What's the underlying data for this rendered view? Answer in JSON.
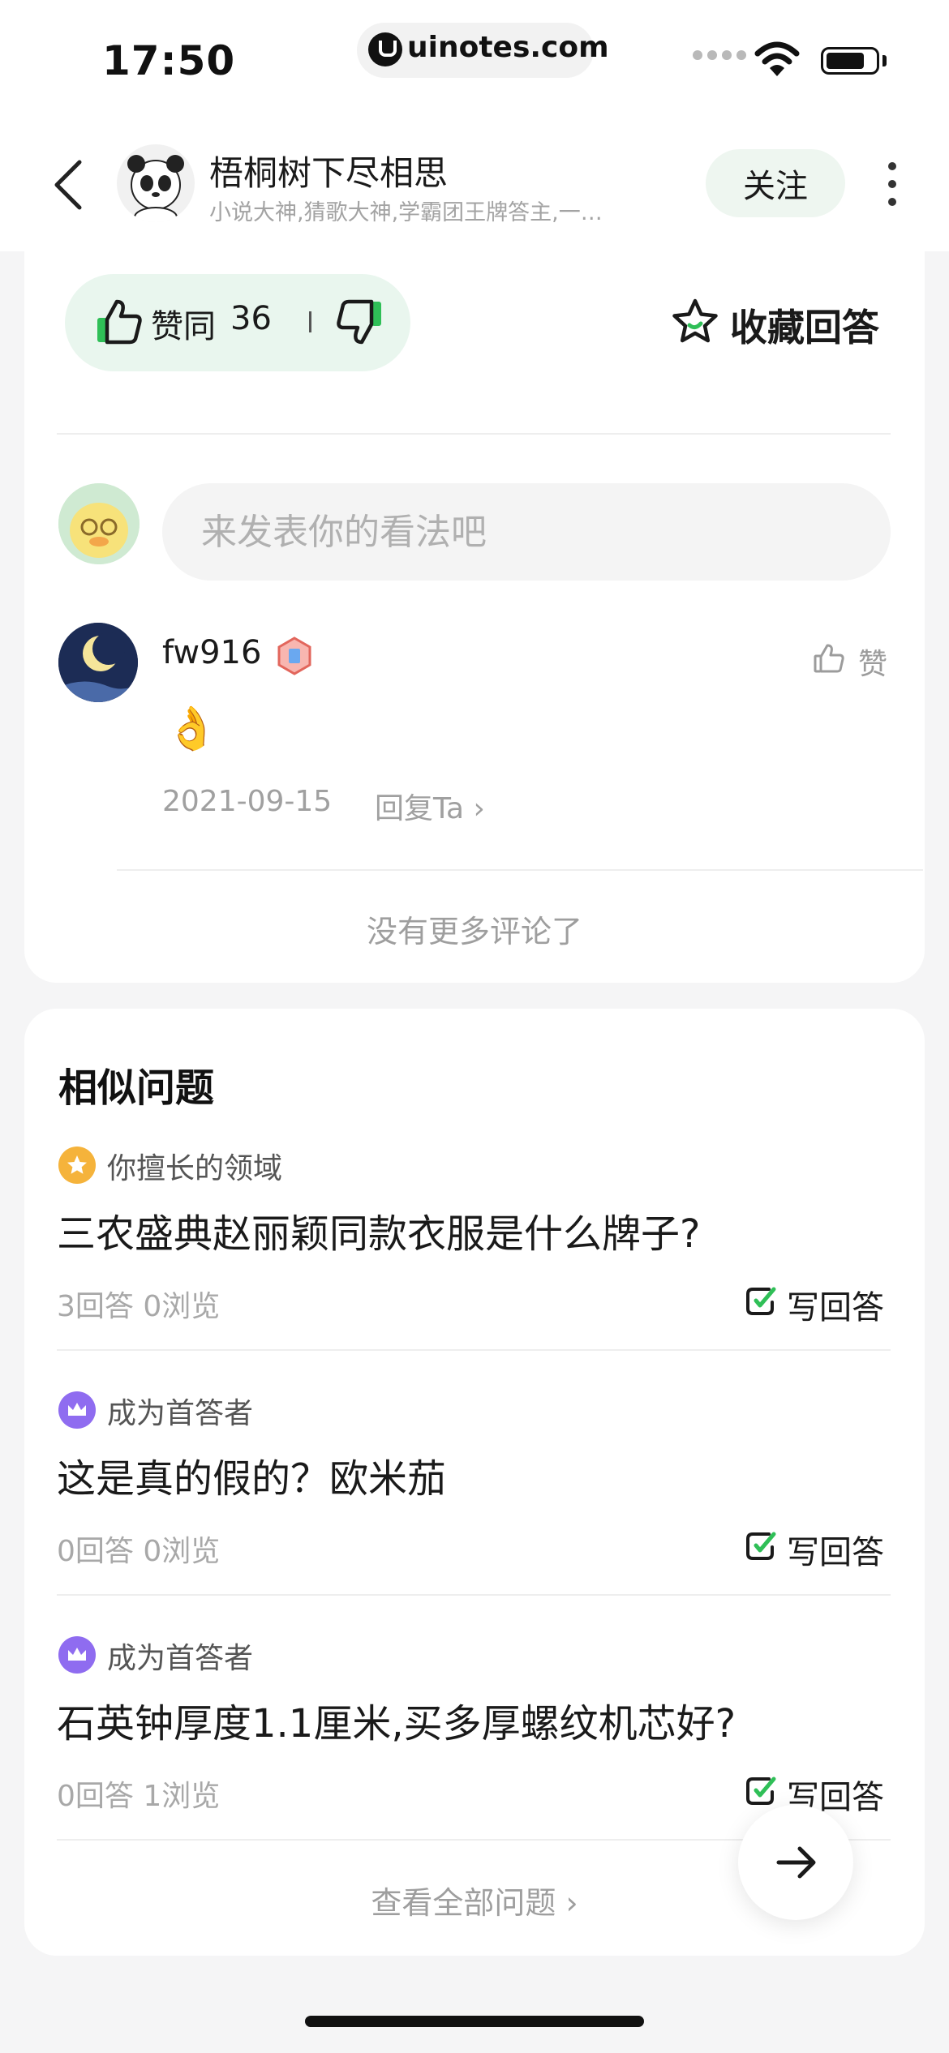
{
  "status_bar": {
    "time": "17:50",
    "url": "uinotes.com"
  },
  "header": {
    "author_name": "梧桐树下尽相思",
    "author_desc": "小说大神,猜歌大神,学霸团王牌答主,一…",
    "follow_label": "关注"
  },
  "actions": {
    "agree_label": "赞同",
    "agree_count": "36",
    "favorite_label": "收藏回答"
  },
  "comment_box": {
    "placeholder": "来发表你的看法吧"
  },
  "comments": [
    {
      "user": "fw916",
      "content": "👌",
      "date": "2021-09-15",
      "reply_label": "回复Ta ›",
      "like_label": "赞"
    }
  ],
  "no_more_comments": "没有更多评论了",
  "similar": {
    "title": "相似问题",
    "questions": [
      {
        "tag": "你擅长的领域",
        "tag_color": "#f5b33b",
        "text": "三农盛典赵丽颖同款衣服是什么牌子?",
        "stats": "3回答   0浏览",
        "write_label": "写回答"
      },
      {
        "tag": "成为首答者",
        "tag_color": "#8f6cf0",
        "text": "这是真的假的？欧米茄",
        "stats": "0回答   0浏览",
        "write_label": "写回答"
      },
      {
        "tag": "成为首答者",
        "tag_color": "#8f6cf0",
        "text": "石英钟厚度1.1厘米,买多厚螺纹机芯好?",
        "stats": "0回答   1浏览",
        "write_label": "写回答"
      }
    ],
    "view_all_label": "查看全部问题  ›"
  },
  "colors": {
    "accent_green": "#2fbf57",
    "pill_bg": "#e9f6ee"
  }
}
